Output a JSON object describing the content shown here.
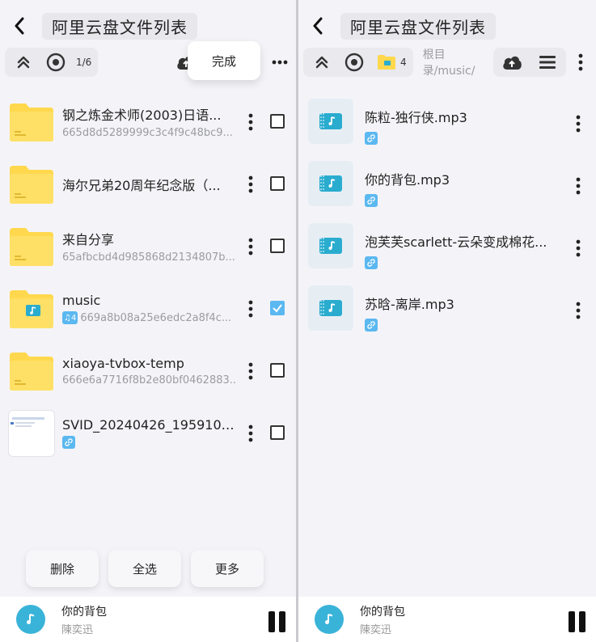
{
  "left": {
    "title": "阿里云盘文件列表",
    "page_counter": "1/6",
    "done_label": "完成",
    "files": [
      {
        "name": "钢之炼金术师(2003)日语...",
        "sub": "665d8d5289999c3c4f9c48bc9...",
        "type": "folder",
        "checked": false
      },
      {
        "name": "海尔兄弟20周年纪念版（...",
        "sub": "",
        "type": "folder",
        "checked": false
      },
      {
        "name": "来自分享",
        "sub": "65afbcbd4d985868d2134807b...",
        "type": "folder",
        "checked": false
      },
      {
        "name": "music",
        "sub": "669a8b08a25e6edc2a8f4c...",
        "badge": "♫4",
        "type": "music-folder",
        "checked": true
      },
      {
        "name": "xiaoya-tvbox-temp",
        "sub": "666e6a7716f8b2e80bf0462883...",
        "type": "folder",
        "checked": false
      },
      {
        "name": "SVID_20240426_195910_...",
        "sub": "",
        "link_badge": true,
        "type": "image",
        "checked": false
      }
    ],
    "actions": {
      "delete": "删除",
      "select_all": "全选",
      "more": "更多"
    }
  },
  "right": {
    "title": "阿里云盘文件列表",
    "folder_count": "4",
    "path": "根目录/music/",
    "files": [
      {
        "name": "陈粒-独行侠.mp3"
      },
      {
        "name": "你的背包.mp3"
      },
      {
        "name": "泡芙芙scarlett-云朵变成棉花..."
      },
      {
        "name": "苏晗-离岸.mp3"
      }
    ]
  },
  "player": {
    "title": "你的背包",
    "artist": "陳奕迅"
  },
  "colors": {
    "accent": "#5bb8f0",
    "folder": "#ffd84d",
    "disc": "#3ab3d8",
    "music_icon": "#2aaccf"
  }
}
